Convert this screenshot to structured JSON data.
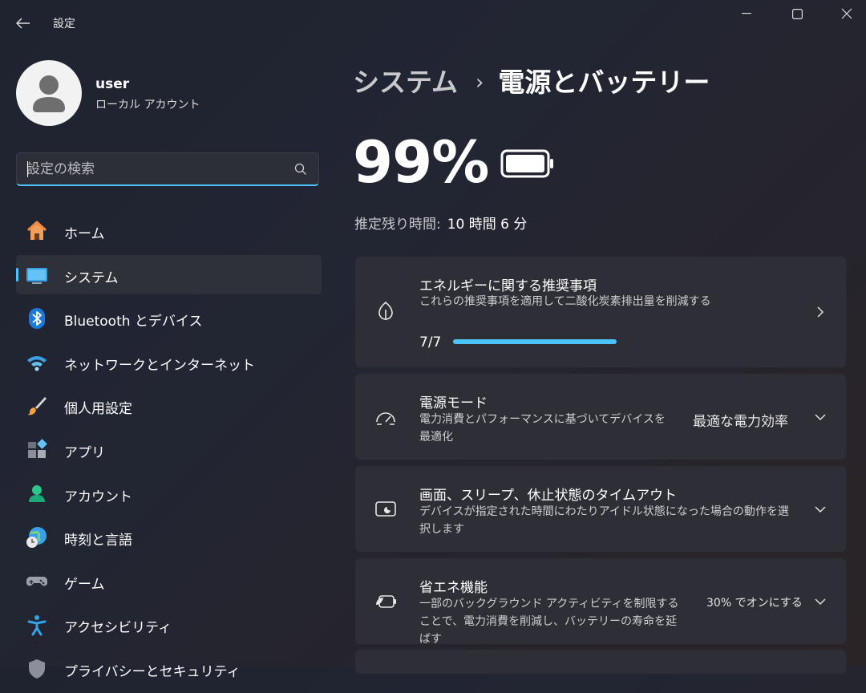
{
  "window": {
    "title": "設定"
  },
  "profile": {
    "name": "user",
    "account_type": "ローカル アカウント"
  },
  "search": {
    "placeholder": "設定の検索",
    "value": ""
  },
  "nav": {
    "items": [
      {
        "label": "ホーム",
        "icon": "home-icon"
      },
      {
        "label": "システム",
        "icon": "system-icon",
        "active": true
      },
      {
        "label": "Bluetooth とデバイス",
        "icon": "bluetooth-icon"
      },
      {
        "label": "ネットワークとインターネット",
        "icon": "wifi-icon"
      },
      {
        "label": "個人用設定",
        "icon": "brush-icon"
      },
      {
        "label": "アプリ",
        "icon": "apps-icon"
      },
      {
        "label": "アカウント",
        "icon": "account-icon"
      },
      {
        "label": "時刻と言語",
        "icon": "globe-clock-icon"
      },
      {
        "label": "ゲーム",
        "icon": "gamepad-icon"
      },
      {
        "label": "アクセシビリティ",
        "icon": "accessibility-icon"
      },
      {
        "label": "プライバシーとセキュリティ",
        "icon": "shield-icon"
      }
    ]
  },
  "breadcrumb": {
    "parent": "システム",
    "separator": "›",
    "current": "電源とバッテリー"
  },
  "battery": {
    "percent": "99%",
    "remaining_label": "推定残り時間:",
    "remaining_value": "10 時間 6 分"
  },
  "cards": {
    "energy": {
      "title": "エネルギーに関する推奨事項",
      "desc": "これらの推奨事項を適用して二酸化炭素排出量を削減する",
      "progress_text": "7/7",
      "progress": 1.0
    },
    "power_mode": {
      "title": "電源モード",
      "desc": "電力消費とパフォーマンスに基づいてデバイスを最適化",
      "value": "最適な電力効率"
    },
    "screen_sleep": {
      "title": "画面、スリープ、休止状態のタイムアウト",
      "desc": "デバイスが指定された時間にわたりアイドル状態になった場合の動作を選択します"
    },
    "energy_saver": {
      "title": "省エネ機能",
      "desc": "一部のバックグラウンド アクティビティを制限することで、電力消費を削減し、バッテリーの寿命を延ばす",
      "value": "30% でオンにする"
    }
  },
  "colors": {
    "accent": "#4cc2ff",
    "card_bg": "#2d2e36",
    "active_nav_bg": "#2f3139"
  }
}
